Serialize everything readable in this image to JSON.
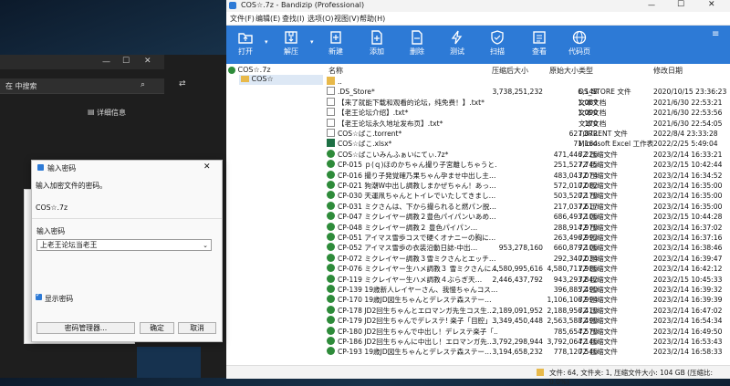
{
  "explorer": {
    "search_placeholder": "在 中搜索",
    "details_label": "详细信息"
  },
  "bandizip": {
    "title": "COS☆.7z - Bandizip (Professional)",
    "menu": [
      "文件(F)",
      "编辑(E)",
      "查找(I)",
      "选项(O)",
      "视图(V)",
      "帮助(H)"
    ],
    "toolbar": [
      {
        "label": "打开",
        "icon": "folder-open-icon"
      },
      {
        "label": "解压",
        "icon": "extract-icon"
      },
      {
        "label": "新建",
        "icon": "new-archive-icon"
      },
      {
        "label": "添加",
        "icon": "add-file-icon"
      },
      {
        "label": "删除",
        "icon": "delete-file-icon"
      },
      {
        "label": "测试",
        "icon": "lightning-icon"
      },
      {
        "label": "扫描",
        "icon": "shield-icon"
      },
      {
        "label": "查看",
        "icon": "view-icon"
      },
      {
        "label": "代码页",
        "icon": "globe-icon"
      }
    ],
    "tree": {
      "root": "COS☆.7z",
      "child": "COS☆"
    },
    "columns": {
      "name": "名称",
      "csize": "压缩后大小",
      "osize": "原始大小",
      "type": "类型",
      "date": "修改日期"
    },
    "rows": [
      {
        "name": "..",
        "csize": "",
        "osize": "",
        "type": "",
        "date": "",
        "icon": "folder-icon"
      },
      {
        "name": ".DS_Store*",
        "csize": "3,738,251,232",
        "osize": "6,148",
        "type": "DS_STORE 文件",
        "date": "2020/10/15 23:36:23",
        "icon": "file-icon"
      },
      {
        "name": "【来了就能下载和观看的论坛，纯免费！】.txt*",
        "csize": "",
        "osize": "1,087",
        "type": "文本文档",
        "date": "2021/6/30 22:53:21",
        "icon": "file-icon"
      },
      {
        "name": "【老王论坛介绍】.txt*",
        "csize": "",
        "osize": "1,090",
        "type": "文本文档",
        "date": "2021/6/30 22:53:56",
        "icon": "file-icon"
      },
      {
        "name": "【老王论坛永久地址发布页】.txt*",
        "csize": "",
        "osize": "170",
        "type": "文本文档",
        "date": "2021/6/30 22:54:05",
        "icon": "file-icon"
      },
      {
        "name": "COS☆ばこ.torrent*",
        "csize": "",
        "osize": "627,872",
        "type": "TORRENT 文件",
        "date": "2022/8/4 23:33:28",
        "icon": "file-icon"
      },
      {
        "name": "COS☆ばこ.xlsx*",
        "csize": "",
        "osize": "71,164",
        "type": "Microsoft Excel 工作表",
        "date": "2022/2/25 5:49:04",
        "icon": "excel-icon"
      },
      {
        "name": "COS☆ばこいみんふぁいにてぃ.7z*",
        "csize": "",
        "osize": "471,446,226",
        "type": "7Z 压缩文件",
        "date": "2023/2/14 16:33:21",
        "icon": "archive-icon"
      },
      {
        "name": "CP-015 ｐ(ｑ)ほのかちゃん撮り子宮離しちゃうと…",
        "csize": "",
        "osize": "251,527,745",
        "type": "7Z 压缩文件",
        "date": "2023/2/15 10:42:44",
        "icon": "archive-icon"
      },
      {
        "name": "CP-016 撮り子発覚確乃果ちゃん孕ませ中出し主…",
        "csize": "",
        "osize": "483,043,074",
        "type": "7Z 压缩文件",
        "date": "2023/2/14 16:34:52",
        "icon": "archive-icon"
      },
      {
        "name": "CP-021 狗潮W中出し調教しまかぜちゃん！あっ…",
        "csize": "",
        "osize": "572,010,082",
        "type": "7Z 压缩文件",
        "date": "2023/2/14 16:35:00",
        "icon": "archive-icon"
      },
      {
        "name": "CP-030 天運凧ちゃんとトイレでいたしてきまし…",
        "csize": "",
        "osize": "503,520,178",
        "type": "7Z 压缩文件",
        "date": "2023/2/14 16:35:00",
        "icon": "archive-icon"
      },
      {
        "name": "CP-031 ミクさんは、下から撮られると燃パン脱…",
        "csize": "",
        "osize": "217,037,617",
        "type": "7Z 压缩文件",
        "date": "2023/2/14 16:35:00",
        "icon": "archive-icon"
      },
      {
        "name": "CP-047 ミクレイヤー調教２豊色パイパンいあめ…",
        "csize": "",
        "osize": "686,493,106",
        "type": "7Z 压缩文件",
        "date": "2023/2/15 10:44:28",
        "icon": "archive-icon"
      },
      {
        "name": "CP-048 ミクレイヤー調教２ 豊色パイパン…",
        "csize": "",
        "osize": "288,914,978",
        "type": "7Z 压缩文件",
        "date": "2023/2/14 16:37:02",
        "icon": "archive-icon"
      },
      {
        "name": "CP-051 アイマス雪歩コスで硬くオナニーの胸に…",
        "csize": "",
        "osize": "263,496,993",
        "type": "7Z 压缩文件",
        "date": "2023/2/14 16:37:16",
        "icon": "archive-icon"
      },
      {
        "name": "CP-052 アイマス雪歩の衣装沿動日誌-中出…",
        "csize": "953,278,160",
        "osize": "660,879,106",
        "type": "7Z 压缩文件",
        "date": "2023/2/14 16:38:46",
        "icon": "archive-icon"
      },
      {
        "name": "CP-072 ミクレイヤー調教３雪ミクさんとエッチ…",
        "csize": "",
        "osize": "292,340,034",
        "type": "7Z 压缩文件",
        "date": "2023/2/14 16:39:47",
        "icon": "archive-icon"
      },
      {
        "name": "CP-076 ミクレイヤー生ハメ調教３ 雪ミクさんに…",
        "csize": "4,580,995,616",
        "osize": "4,580,711,986",
        "type": "7Z 压缩文件",
        "date": "2023/2/14 16:42:12",
        "icon": "archive-icon"
      },
      {
        "name": "CP-119 ミクレイヤー生ハメ調教４ぶらぎ天…",
        "csize": "2,446,437,792",
        "osize": "943,293,842",
        "type": "7Z 压缩文件",
        "date": "2023/2/15 10:45:33",
        "icon": "archive-icon"
      },
      {
        "name": "CP-139 19歳新人レイヤーさん、我慢ちゃんコス…",
        "csize": "",
        "osize": "396,885,490",
        "type": "7Z 压缩文件",
        "date": "2023/2/14 16:39:32",
        "icon": "archive-icon"
      },
      {
        "name": "CP-170 19歳JD図生ちゃんとデレステ森ステー…",
        "csize": "",
        "osize": "1,106,106,994",
        "type": "7Z 压缩文件",
        "date": "2023/2/14 16:39:39",
        "icon": "archive-icon"
      },
      {
        "name": "CP-178 JD2回生ちゃんとエロマンガ先生コス生…",
        "csize": "2,189,091,952",
        "osize": "2,188,956,418",
        "type": "7Z 压缩文件",
        "date": "2023/2/14 16:47:02",
        "icon": "archive-icon"
      },
      {
        "name": "CP-179 JD2回生ちゃんでデレステ! 楽子「目腔」…",
        "csize": "3,349,450,448",
        "osize": "2,563,588,498",
        "type": "7Z 压缩文件",
        "date": "2023/2/14 16:54:34",
        "icon": "archive-icon"
      },
      {
        "name": "CP-180 JD2回生ちゃんで中出し！デレステ楽子「…",
        "csize": "",
        "osize": "785,654,578",
        "type": "7Z 压缩文件",
        "date": "2023/2/14 16:49:50",
        "icon": "archive-icon"
      },
      {
        "name": "CP-186 JD2回生ちゃんに中出し！エロマンガ先…",
        "csize": "3,792,298,944",
        "osize": "3,792,064,146",
        "type": "7Z 压缩文件",
        "date": "2023/2/14 16:53:43",
        "icon": "archive-icon"
      },
      {
        "name": "CP-193 19歳JD図生ちゃんとデレステ森ステー…",
        "csize": "3,194,658,232",
        "osize": "778,120,546",
        "type": "7Z 压缩文件",
        "date": "2023/2/14 16:58:33",
        "icon": "archive-icon"
      }
    ],
    "status": "文件: 64, 文件夹: 1, 压缩文件大小: 104 GB (压缩比: 0.0%)"
  },
  "dialog": {
    "title": "输入密码",
    "prompt": "输入加密文件的密码。",
    "filename": "COS☆.7z",
    "password_label": "输入密码",
    "password_value": "上老王论坛当老王",
    "show_password": "显示密码",
    "manager_button": "密码管理器...",
    "ok_button": "确定",
    "cancel_button": "取消"
  },
  "colors": {
    "toolbar_blue": "#2d7ad6",
    "selection": "#dde8f5",
    "archive_green": "#2e8b3a"
  }
}
